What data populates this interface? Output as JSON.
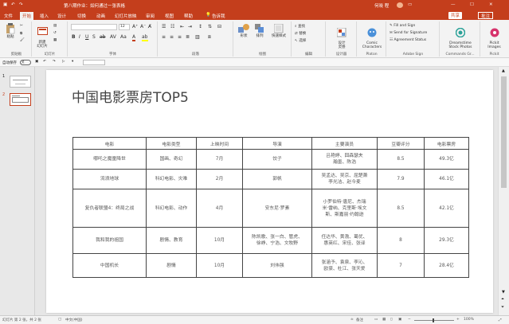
{
  "window": {
    "title": "第八期作业：如何通过一张表格",
    "user": "何晓 程",
    "window_buttons": [
      "—",
      "☐",
      "✕"
    ]
  },
  "tabs": [
    {
      "label": "文件"
    },
    {
      "label": "开始"
    },
    {
      "label": "插入"
    },
    {
      "label": "设计"
    },
    {
      "label": "切换"
    },
    {
      "label": "动画"
    },
    {
      "label": "幻灯片放映"
    },
    {
      "label": "审阅"
    },
    {
      "label": "视图"
    },
    {
      "label": "帮助"
    }
  ],
  "tell_me": "告诉我",
  "share_label": "共享",
  "comments_label": "批注",
  "ribbon": {
    "clipboard": {
      "paste": "粘贴",
      "label": "剪贴板"
    },
    "slides": {
      "new_slide": "新建\n幻灯片",
      "label": "幻灯片"
    },
    "font": {
      "font_name": "",
      "font_size": "12",
      "label": "字体"
    },
    "paragraph": {
      "label": "段落"
    },
    "drawing": {
      "shapes": "形状",
      "arrange": "排列",
      "quick_styles": "快速样式",
      "label": "绘图"
    },
    "editing": {
      "find": "查找",
      "replace": "替换",
      "select": "选择",
      "label": "编辑"
    },
    "designer": {
      "ideas": "设计\n灵感",
      "label": "设计器"
    },
    "platon": {
      "btn": "Comic\nCharacters",
      "label": "Platon"
    },
    "adobe_sign": {
      "fill": "Fill and Sign",
      "send": "Send for Signature",
      "status": "Agreement Status",
      "label": "Adobe Sign"
    },
    "dreamstime": {
      "btn": "Dreamstime\nStock Photos",
      "label": "Commands Gr..."
    },
    "pickit": {
      "btn": "Pickit\nImages",
      "label": "Pickit"
    }
  },
  "qat": {
    "autosave": "自动保存",
    "autosave_state": "关"
  },
  "thumbnails": [
    {
      "number": "1"
    },
    {
      "number": "2"
    }
  ],
  "slide": {
    "title": "中国电影票房TOP5",
    "table": {
      "headers": [
        "电影",
        "电影类型",
        "上映时间",
        "导演",
        "主要演员",
        "豆瓣评分",
        "电影票房"
      ],
      "rows": [
        [
          "哪吒之魔童降世",
          "国画、奇幻",
          "7月",
          "饺子",
          "吕艳婷、囧森瑟夫\n瀚墨、陈浩",
          "8.5",
          "49.3亿"
        ],
        [
          "流浪地球",
          "科幻电影、灾难",
          "2月",
          "郭帆",
          "吴孟达、吴京、屈楚萧\n李光洁、赵今麦",
          "7.9",
          "46.1亿"
        ],
        [
          "复仇者联盟4：终局之战",
          "科幻电影、动作",
          "4月",
          "安东尼·罗素",
          "小罗伯特·唐尼、杰瑞\n米·雷纳、克里斯·埃文\n斯、斯嘉丽·约翰逊",
          "8.5",
          "42.1亿"
        ],
        [
          "我和我的祖国",
          "剧情、教育",
          "10月",
          "陈凯歌、张一白、管虎、\n徐峥、宁浩、文牧野",
          "任达华、黄渤、葛优、\n惠英红、宋佳、张译",
          "8",
          "29.3亿"
        ],
        [
          "中国机长",
          "剧情",
          "10月",
          "刘伟强",
          "张涵予、袁泉、李沁、\n欧豪、杜江、张天爱",
          "7",
          "28.4亿"
        ]
      ]
    }
  },
  "status": {
    "slide_info": "幻灯片 第 2 张，共 2 张",
    "language": "中文(中国)",
    "notes": "备注",
    "zoom": "100%"
  },
  "colors": {
    "accent": "#c43e1c"
  }
}
